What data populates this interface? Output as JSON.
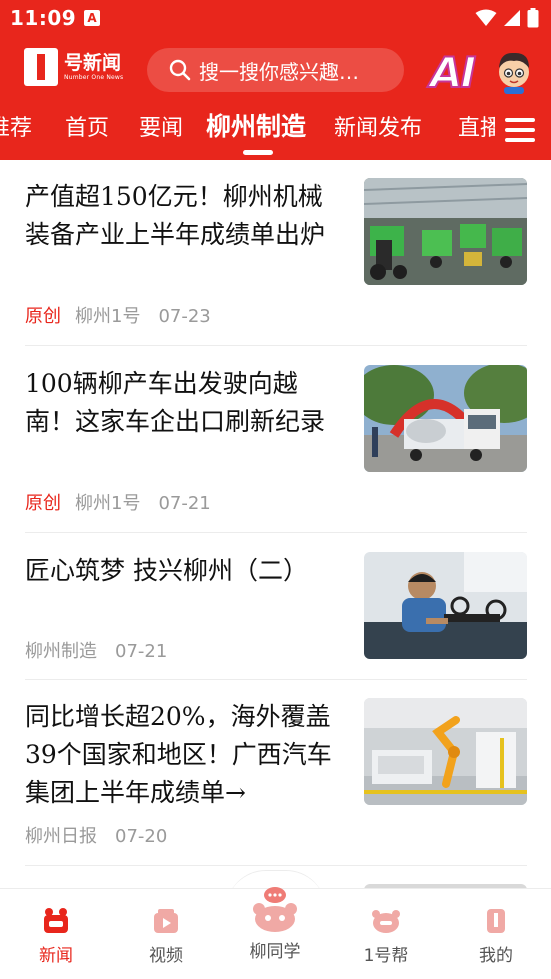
{
  "status_bar": {
    "time": "11:09",
    "app_icon_letter": "A"
  },
  "header": {
    "logo_name": "号新闻",
    "logo_sub": "Number One News",
    "search_placeholder": "搜一搜你感兴趣…",
    "ai_label": "AI"
  },
  "tabs": [
    {
      "label": "推荐"
    },
    {
      "label": "首页"
    },
    {
      "label": "要闻"
    },
    {
      "label": "柳州制造",
      "active": true
    },
    {
      "label": "新闻发布"
    },
    {
      "label": "直播"
    }
  ],
  "articles": [
    {
      "title": "产值超150亿元！柳州机械装备产业上半年成绩单出炉",
      "tag": "原创",
      "source": "柳州1号",
      "date": "07-23",
      "image": "factory-floor-green-machines"
    },
    {
      "title": "100辆柳产车出发驶向越南！这家车企出口刷新纪录",
      "tag": "原创",
      "source": "柳州1号",
      "date": "07-21",
      "image": "mixer-trucks-red-arch"
    },
    {
      "title": "匠心筑梦  技兴柳州（二）",
      "tag": "",
      "source": "柳州制造",
      "date": "07-21",
      "image": "worker-assembling-drone"
    },
    {
      "title": "同比增长超20%，海外覆盖39个国家和地区！广西汽车集团上半年成绩单→",
      "tag": "",
      "source": "柳州日报",
      "date": "07-20",
      "image": "robot-arm-production-line"
    }
  ],
  "bottom_nav": [
    {
      "label": "新闻",
      "icon": "news-icon",
      "active": true
    },
    {
      "label": "视频",
      "icon": "video-icon"
    },
    {
      "label": "柳同学",
      "icon": "assistant-icon"
    },
    {
      "label": "1号帮",
      "icon": "help-icon"
    },
    {
      "label": "我的",
      "icon": "profile-icon"
    }
  ],
  "colors": {
    "brand_red": "#e8261c",
    "muted_text": "#9a9a9a",
    "title_text": "#111111"
  }
}
